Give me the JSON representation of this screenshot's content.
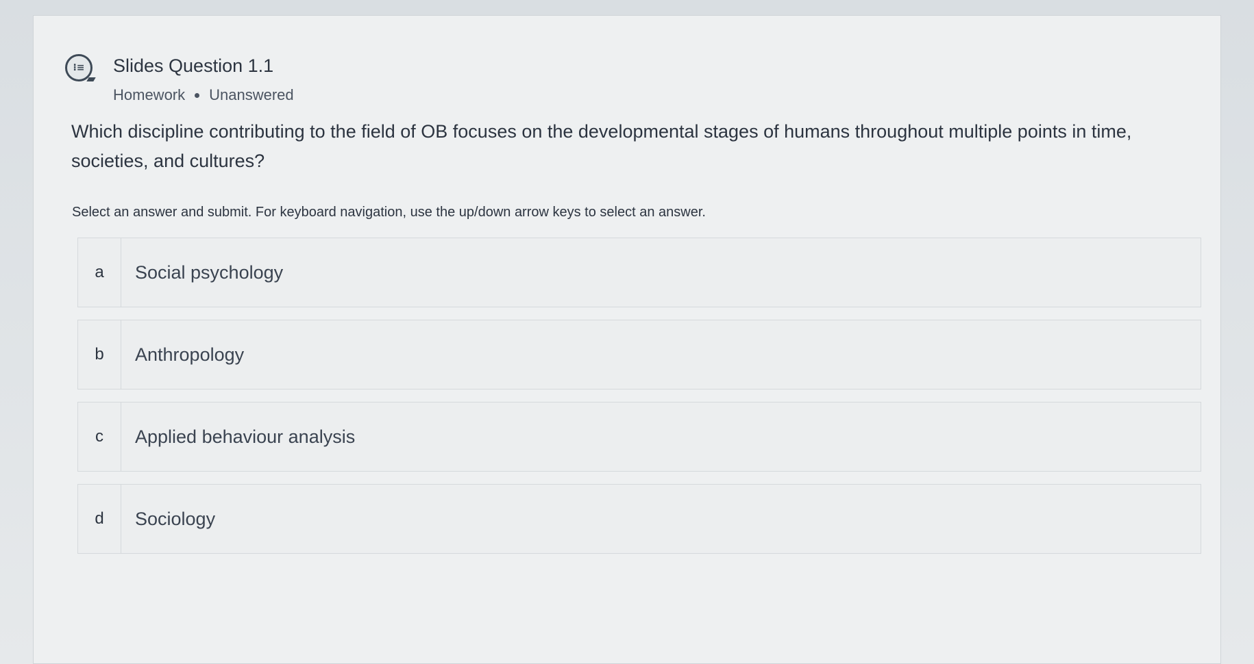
{
  "header": {
    "icon": "question-bubble-icon",
    "title": "Slides Question 1.1",
    "category": "Homework",
    "status": "Unanswered"
  },
  "question": {
    "text": "Which discipline contributing to the field of OB focuses on the developmental stages of humans throughout multiple points in time, societies, and cultures?"
  },
  "instructions": "Select an answer and submit. For keyboard navigation, use the up/down arrow keys to select an answer.",
  "options": [
    {
      "letter": "a",
      "text": "Social psychology"
    },
    {
      "letter": "b",
      "text": "Anthropology"
    },
    {
      "letter": "c",
      "text": "Applied behaviour analysis"
    },
    {
      "letter": "d",
      "text": "Sociology"
    }
  ]
}
